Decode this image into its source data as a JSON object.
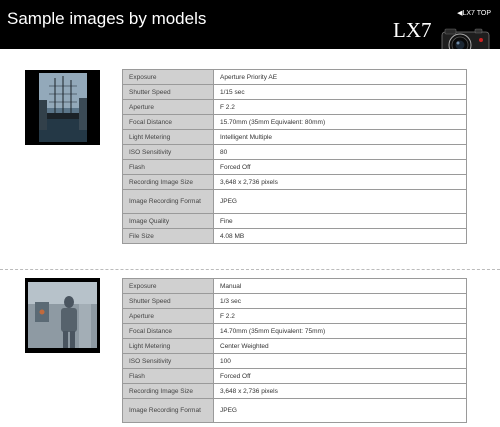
{
  "header": {
    "title": "Sample images by models",
    "top_link": "◀LX7 TOP",
    "model": "LX7"
  },
  "samples": [
    {
      "specs": [
        {
          "label": "Exposure",
          "value": "Aperture Priority AE"
        },
        {
          "label": "Shutter Speed",
          "value": "1/15 sec"
        },
        {
          "label": "Aperture",
          "value": "F 2.2"
        },
        {
          "label": "Focal Distance",
          "value": "15.70mm (35mm Equivalent: 80mm)"
        },
        {
          "label": "Light Metering",
          "value": "Intelligent Multiple"
        },
        {
          "label": "ISO Sensitivity",
          "value": "80"
        },
        {
          "label": "Flash",
          "value": "Forced Off"
        },
        {
          "label": "Recording Image Size",
          "value": "3,648 x 2,736 pixels"
        },
        {
          "label": "Image Recording Format",
          "value": "JPEG"
        },
        {
          "label": "Image Quality",
          "value": "Fine"
        },
        {
          "label": "File Size",
          "value": "4.08 MB"
        }
      ]
    },
    {
      "specs": [
        {
          "label": "Exposure",
          "value": "Manual"
        },
        {
          "label": "Shutter Speed",
          "value": "1/3 sec"
        },
        {
          "label": "Aperture",
          "value": "F 2.2"
        },
        {
          "label": "Focal Distance",
          "value": "14.70mm (35mm Equivalent: 75mm)"
        },
        {
          "label": "Light Metering",
          "value": "Center Weighted"
        },
        {
          "label": "ISO Sensitivity",
          "value": "100"
        },
        {
          "label": "Flash",
          "value": "Forced Off"
        },
        {
          "label": "Recording Image Size",
          "value": "3,648 x 2,736 pixels"
        },
        {
          "label": "Image Recording Format",
          "value": "JPEG"
        }
      ]
    }
  ]
}
